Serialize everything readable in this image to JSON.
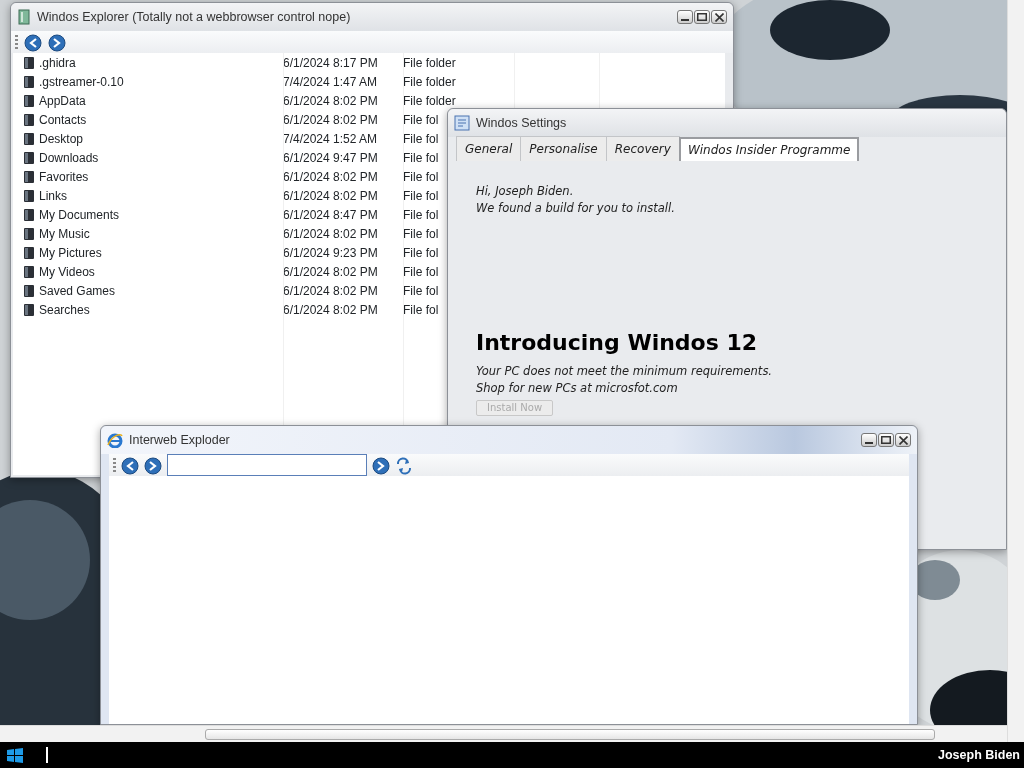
{
  "explorer": {
    "title": "Windos Explorer (Totally not a webbrowser control nope)",
    "rows": [
      {
        "name": ".ghidra",
        "modified": "6/1/2024 8:17 PM",
        "type": "File folder"
      },
      {
        "name": ".gstreamer-0.10",
        "modified": "7/4/2024 1:47 AM",
        "type": "File folder"
      },
      {
        "name": "AppData",
        "modified": "6/1/2024 8:02 PM",
        "type": "File folder"
      },
      {
        "name": "Contacts",
        "modified": "6/1/2024 8:02 PM",
        "type": "File fol"
      },
      {
        "name": "Desktop",
        "modified": "7/4/2024 1:52 AM",
        "type": "File fol"
      },
      {
        "name": "Downloads",
        "modified": "6/1/2024 9:47 PM",
        "type": "File fol"
      },
      {
        "name": "Favorites",
        "modified": "6/1/2024 8:02 PM",
        "type": "File fol"
      },
      {
        "name": "Links",
        "modified": "6/1/2024 8:02 PM",
        "type": "File fol"
      },
      {
        "name": "My Documents",
        "modified": "6/1/2024 8:47 PM",
        "type": "File fol"
      },
      {
        "name": "My Music",
        "modified": "6/1/2024 8:02 PM",
        "type": "File fol"
      },
      {
        "name": "My Pictures",
        "modified": "6/1/2024 9:23 PM",
        "type": "File fol"
      },
      {
        "name": "My Videos",
        "modified": "6/1/2024 8:02 PM",
        "type": "File fol"
      },
      {
        "name": "Saved Games",
        "modified": "6/1/2024 8:02 PM",
        "type": "File fol"
      },
      {
        "name": "Searches",
        "modified": "6/1/2024 8:02 PM",
        "type": "File fol"
      }
    ]
  },
  "settings": {
    "title": "Windos Settings",
    "tabs": [
      {
        "label": "General",
        "selected": false
      },
      {
        "label": "Personalise",
        "selected": false
      },
      {
        "label": "Recovery",
        "selected": false
      },
      {
        "label": "Windos Insider Programme",
        "selected": true
      }
    ],
    "greeting": "Hi, Joseph Biden.",
    "message": "We found a build for you to install.",
    "heading": "Introducing Windos 12",
    "requirements": "Your PC does not meet the minimum requirements.",
    "shop": "Shop for new PCs at microsfot.com",
    "install_button": {
      "label": "Install Now",
      "disabled": true
    }
  },
  "browser": {
    "title": "Interweb Exploder"
  },
  "taskbar": {
    "user": "Joseph Biden"
  }
}
